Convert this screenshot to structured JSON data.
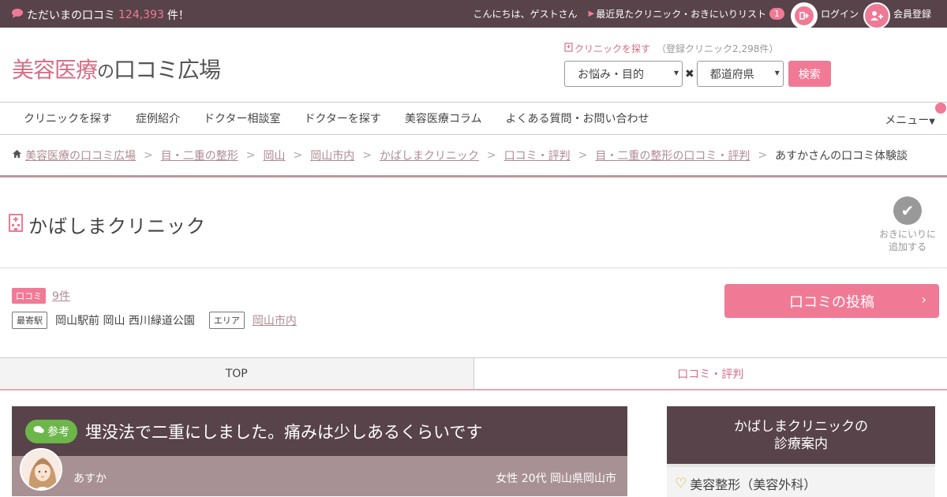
{
  "topbar": {
    "review_prefix": "ただいまの口コミ",
    "review_count": "124,393",
    "review_suffix": "件！",
    "greeting": "こんにちは、ゲストさん",
    "recent_label": "最近見たクリニック・おきにいりリスト",
    "recent_count": "1",
    "login_label": "ログイン",
    "register_label": "会員登録"
  },
  "logo": {
    "part1": "美容医療",
    "part2": "の",
    "part3": "口コミ広場"
  },
  "search": {
    "label": "クリニックを探す",
    "registered": "（登録クリニック2,298件）",
    "concern_select": "お悩み・目的",
    "pref_select": "都道府県",
    "button": "検索"
  },
  "nav": {
    "items": [
      "クリニックを探す",
      "症例紹介",
      "ドクター相談室",
      "ドクターを探す",
      "美容医療コラム",
      "よくある質問・お問い合わせ"
    ],
    "menu": "メニュー"
  },
  "breadcrumb": {
    "items": [
      "美容医療の口コミ広場",
      "目・二重の整形",
      "岡山",
      "岡山市内",
      "かばしまクリニック",
      "口コミ・評判",
      "目・二重の整形の口コミ・評判"
    ],
    "current": "あすかさんの口コミ体験談"
  },
  "clinic": {
    "name": "かばしまクリニック",
    "favorite_label_1": "おきにいりに",
    "favorite_label_2": "追加する"
  },
  "info": {
    "review_tag": "口コミ",
    "review_count": "9件",
    "station_tag": "最寄駅",
    "stations": "岡山駅前  岡山  西川緑道公園",
    "area_tag": "エリア",
    "area": "岡山市内",
    "post_button": "口コミの投稿"
  },
  "tabs": {
    "top": "TOP",
    "reviews": "口コミ・評判"
  },
  "review": {
    "badge": "参考",
    "title": "埋没法で二重にしました。痛みは少しあるくらいです",
    "reviewer": "あすか",
    "meta": "女性 20代 岡山県岡山市"
  },
  "sidebar": {
    "head_line1": "かばしまクリニックの",
    "head_line2": "診療案内",
    "category": "美容整形（美容外科）"
  },
  "colors": {
    "topbar_bg": "#58434a",
    "accent_pink": "#f07a96",
    "badge_green": "#6cb64a"
  }
}
